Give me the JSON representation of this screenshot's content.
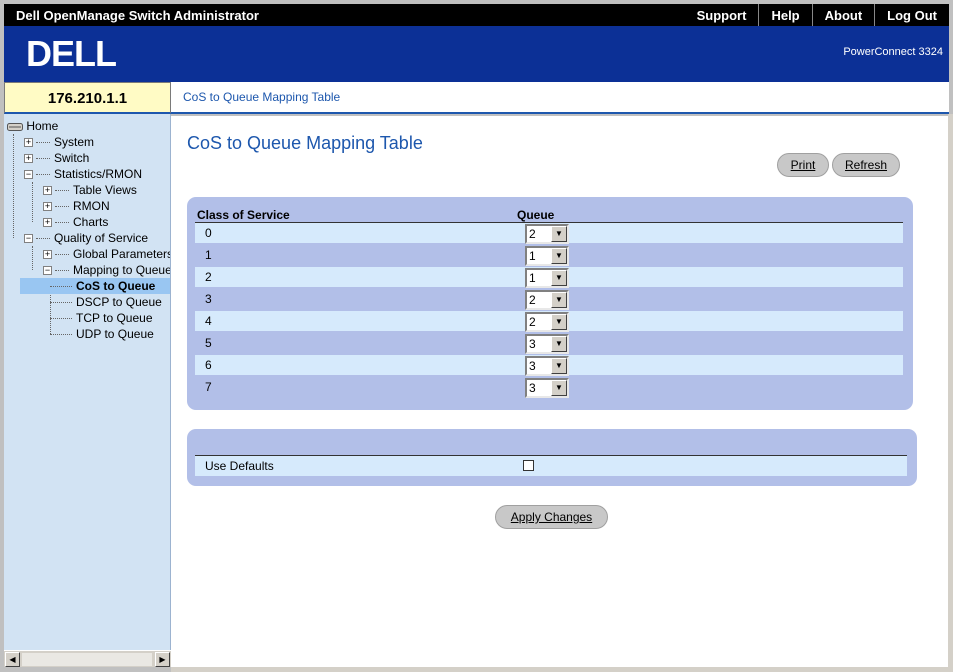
{
  "window": {
    "title": "Dell OpenManage Switch Administrator",
    "links": [
      "Support",
      "Help",
      "About",
      "Log Out"
    ]
  },
  "banner": {
    "logo_text": "DELL",
    "model": "PowerConnect 3324"
  },
  "address": {
    "ip": "176.210.1.1",
    "breadcrumb": "CoS to Queue Mapping Table"
  },
  "tree": {
    "home": "Home",
    "system": "System",
    "switch": "Switch",
    "statistics": "Statistics/RMON",
    "table_views": "Table Views",
    "rmon": "RMON",
    "charts": "Charts",
    "qos": "Quality of Service",
    "global_params": "Global Parameters",
    "mapping": "Mapping to Queue",
    "cos_to_queue": "CoS to Queue",
    "dscp_to_queue": "DSCP to Queue",
    "tcp_to_queue": "TCP to Queue",
    "udp_to_queue": "UDP to Queue",
    "plus": "+",
    "minus": "−"
  },
  "page": {
    "title": "CoS to Queue Mapping Table",
    "print_label": "Print",
    "refresh_label": "Refresh",
    "col_cos": "Class of Service",
    "col_queue": "Queue",
    "rows": [
      {
        "cos": "0",
        "queue": "2"
      },
      {
        "cos": "1",
        "queue": "1"
      },
      {
        "cos": "2",
        "queue": "1"
      },
      {
        "cos": "3",
        "queue": "2"
      },
      {
        "cos": "4",
        "queue": "2"
      },
      {
        "cos": "5",
        "queue": "3"
      },
      {
        "cos": "6",
        "queue": "3"
      },
      {
        "cos": "7",
        "queue": "3"
      }
    ],
    "use_defaults_label": "Use Defaults",
    "use_defaults_checked": false,
    "apply_label": "Apply Changes",
    "dropdown_arrow": "▼"
  },
  "colors": {
    "brand_blue": "#0c3096",
    "link_blue": "#1d57ad",
    "panel": "#b2bfe8",
    "row_light": "#d6eafc"
  },
  "icons": {
    "scroll_left": "◀",
    "scroll_right": "▶"
  }
}
